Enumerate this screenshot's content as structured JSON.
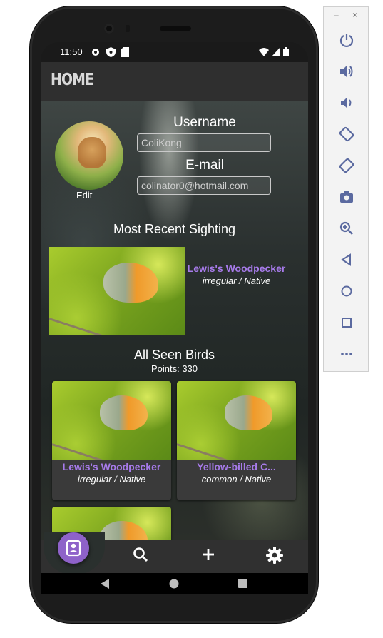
{
  "status_bar": {
    "time": "11:50"
  },
  "app_bar": {
    "title": "HOME"
  },
  "profile": {
    "edit_label": "Edit",
    "username_label": "Username",
    "username_value": "ColiKong",
    "email_label": "E-mail",
    "email_value": "colinator0@hotmail.com"
  },
  "recent": {
    "title": "Most Recent Sighting",
    "bird_name": "Lewis's Woodpecker",
    "bird_status": "irregular / Native"
  },
  "all_seen": {
    "title": "All Seen Birds",
    "points": "Points: 330",
    "cards": [
      {
        "name": "Lewis's Woodpecker",
        "status": "irregular / Native"
      },
      {
        "name": "Yellow-billed C...",
        "status": "common / Native"
      }
    ]
  },
  "bottom_nav": {
    "items": [
      "profile-icon",
      "search-icon",
      "add-icon",
      "settings-icon"
    ]
  },
  "emulator_panel": {
    "window_buttons": [
      "–",
      "×"
    ],
    "controls": [
      "power-icon",
      "volume-up-icon",
      "volume-down-icon",
      "rotate-left-icon",
      "rotate-right-icon",
      "camera-icon",
      "zoom-icon",
      "back-icon",
      "home-icon",
      "overview-icon",
      "more-icon"
    ]
  },
  "colors": {
    "accent": "#a77bea",
    "fab": "#8e62c9",
    "panel_icon": "#5b6aa0"
  }
}
